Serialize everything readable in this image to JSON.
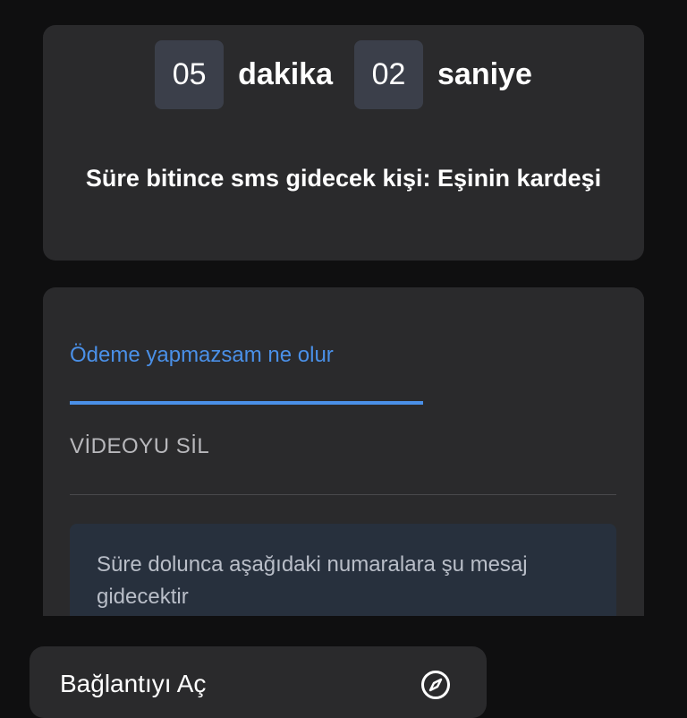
{
  "timer": {
    "minutes": "05",
    "minutes_unit": "dakika",
    "seconds": "02",
    "seconds_unit": "saniye",
    "recipient_text": "Süre bitince sms gidecek kişi: Eşinin kardeşi"
  },
  "tabs": [
    {
      "label": "Ödeme yapmazsam ne olur",
      "active": true
    },
    {
      "label": "VİDEOYU SİL",
      "active": false
    }
  ],
  "info": {
    "text": "Süre dolunca aşağıdaki numaralara şu mesaj gidecektir"
  },
  "link_sheet": {
    "label": "Bağlantıyı Aç",
    "icon": "compass-icon"
  },
  "colors": {
    "background": "#0f0f10",
    "card": "#2a2a2c",
    "accent": "#4a90e8",
    "number_box": "#3b3f4a",
    "info_box": "#27303d"
  }
}
